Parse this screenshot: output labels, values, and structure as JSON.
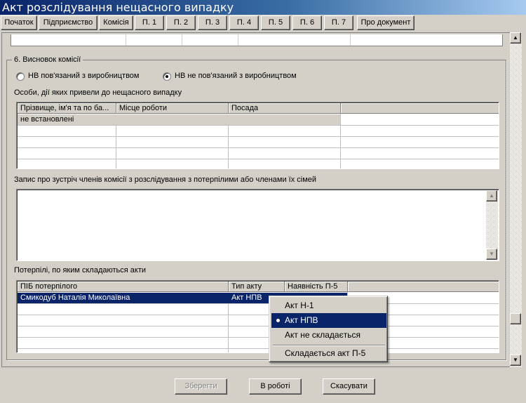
{
  "window": {
    "title": "Акт розслідування нещасного випадку"
  },
  "toolbar": [
    {
      "label": "Початок"
    },
    {
      "label": "Підприємство"
    },
    {
      "label": "Комісія"
    },
    {
      "label": "П. 1"
    },
    {
      "label": "П. 2"
    },
    {
      "label": "П. 3"
    },
    {
      "label": "П. 4"
    },
    {
      "label": "П. 5"
    },
    {
      "label": "П. 6"
    },
    {
      "label": "П. 7"
    },
    {
      "label": "Про документ"
    }
  ],
  "section": {
    "title": "6. Висновок комісії",
    "radio_related": "НВ пов'язаний з виробництвом",
    "radio_unrelated": "НВ не пов'язаний з виробництвом",
    "selected_radio": "unrelated"
  },
  "persons": {
    "label": "Особи, дії яких привели до нещасного випадку",
    "columns": [
      "Прізвище, ім'я та по ба...",
      "Місце роботи",
      "Посада"
    ],
    "rows": [
      [
        "не встановлені",
        "",
        ""
      ]
    ]
  },
  "meeting": {
    "label": "Запис про зустріч членів комісії з розслідування з потерпілими або членами їх сімей",
    "value": ""
  },
  "victims": {
    "label": "Потерпілі, по яким складаються акти",
    "columns": [
      "ПІБ потерпілого",
      "Тип акту",
      "Наявність П-5"
    ],
    "rows": [
      [
        "Смикодуб Наталія Миколаївна",
        "Акт НПВ",
        ""
      ]
    ]
  },
  "popup": {
    "items": [
      "Акт Н-1",
      "Акт НПВ",
      "Акт не складається"
    ],
    "selected": "Акт НПВ",
    "extra": "Складається акт П-5"
  },
  "buttons": {
    "save": "Зберегти",
    "in_work": "В роботі",
    "cancel": "Скасувати"
  }
}
